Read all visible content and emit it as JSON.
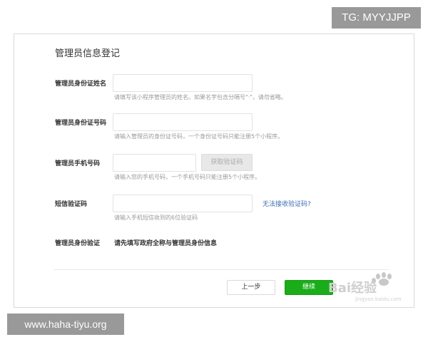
{
  "badge_top": "TG: MYYJJPP",
  "badge_bottom": "www.haha-tiyu.org",
  "form": {
    "title": "管理员信息登记",
    "rows": {
      "name": {
        "label": "管理员身份证姓名",
        "hint": "请填写该小程序管理员的姓名。如果名字包含分隔号\"·\"，请勿省略。"
      },
      "id": {
        "label": "管理员身份证号码",
        "hint": "请输入管理员的身份证号码，一个身份证号码只能注册5个小程序。"
      },
      "phone": {
        "label": "管理员手机号码",
        "button": "获取验证码",
        "hint": "请输入您的手机号码，一个手机号码只能注册5个小程序。"
      },
      "sms": {
        "label": "短信验证码",
        "link": "无法接收验证码?",
        "hint": "请输入手机短信收到的6位验证码"
      },
      "verify": {
        "label": "管理员身份验证",
        "text": "请先填写政府全称与管理员身份信息"
      }
    },
    "buttons": {
      "prev": "上一步",
      "next": "继续"
    }
  },
  "watermark": {
    "text": "Bai经验",
    "site": "jingyan.baidu.com"
  },
  "colors": {
    "primary_green": "#1aad19",
    "link_blue": "#3a6fb0",
    "badge_gray": "#999999"
  }
}
